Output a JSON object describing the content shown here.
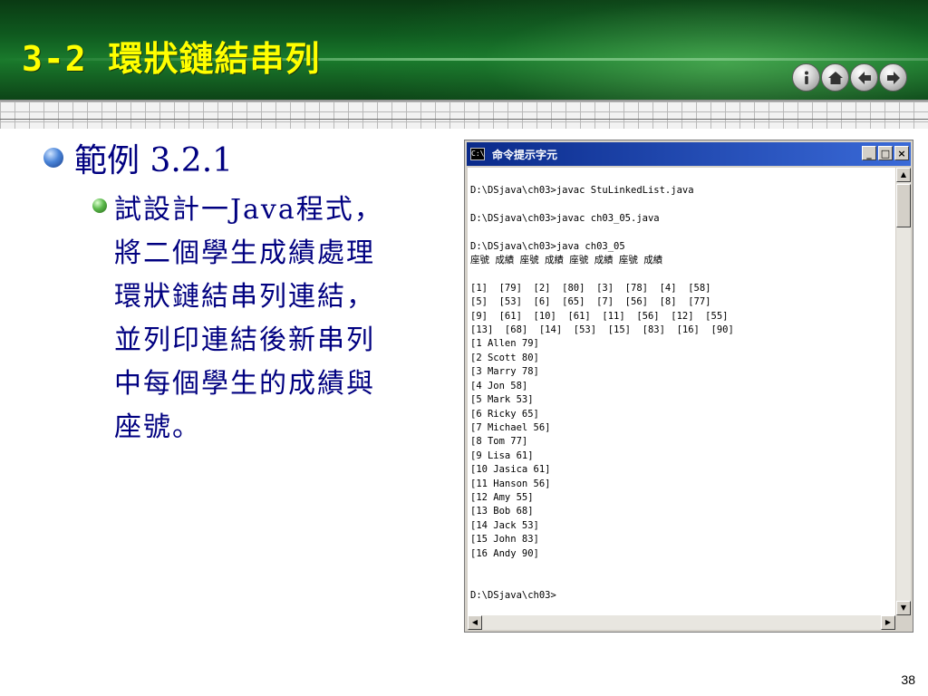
{
  "slide": {
    "title": "3-2 環狀鏈結串列",
    "page_number": "38"
  },
  "nav": [
    {
      "name": "info-icon",
      "glyph": "i"
    },
    {
      "name": "home-icon",
      "glyph": "⌂"
    },
    {
      "name": "back-icon",
      "glyph": "←"
    },
    {
      "name": "forward-icon",
      "glyph": "→"
    }
  ],
  "bullet1": "範例 3.2.1",
  "bullet2_lines": [
    "試設計一Java程式，",
    "將二個學生成績處理",
    "環狀鏈結串列連結，",
    "並列印連結後新串列",
    "中每個學生的成績與",
    "座號。"
  ],
  "console": {
    "title": "命令提示字元",
    "icon_text": "C:\\",
    "controls": [
      "_",
      "□",
      "×"
    ],
    "lines": [
      "D:\\DSjava\\ch03>javac StuLinkedList.java",
      "",
      "D:\\DSjava\\ch03>javac ch03_05.java",
      "",
      "D:\\DSjava\\ch03>java ch03_05",
      "座號 成績 座號 成績 座號 成績 座號 成績",
      "",
      "[1]  [79]  [2]  [80]  [3]  [78]  [4]  [58]",
      "[5]  [53]  [6]  [65]  [7]  [56]  [8]  [77]",
      "[9]  [61]  [10]  [61]  [11]  [56]  [12]  [55]",
      "[13]  [68]  [14]  [53]  [15]  [83]  [16]  [90]",
      "[1 Allen 79]",
      "[2 Scott 80]",
      "[3 Marry 78]",
      "[4 Jon 58]",
      "[5 Mark 53]",
      "[6 Ricky 65]",
      "[7 Michael 56]",
      "[8 Tom 77]",
      "[9 Lisa 61]",
      "[10 Jasica 61]",
      "[11 Hanson 56]",
      "[12 Amy 55]",
      "[13 Bob 68]",
      "[14 Jack 53]",
      "[15 John 83]",
      "[16 Andy 90]",
      "",
      "",
      "D:\\DSjava\\ch03>"
    ]
  }
}
